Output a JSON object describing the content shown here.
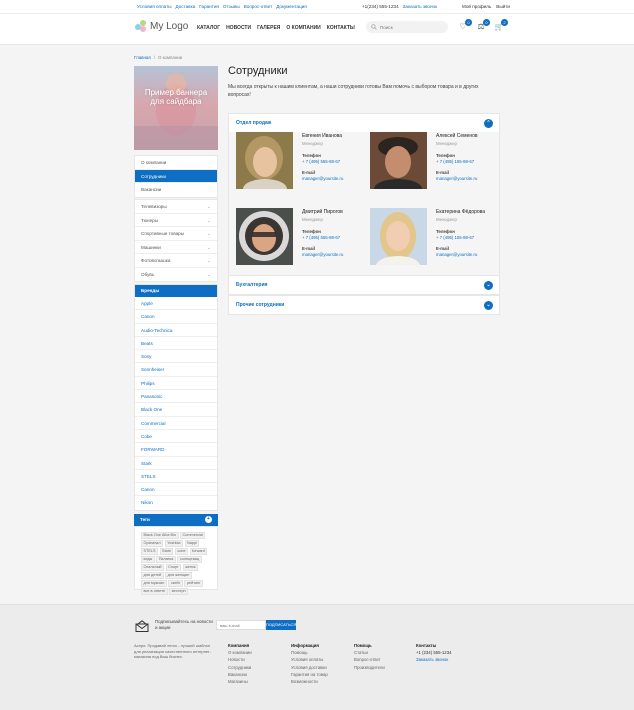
{
  "topbar": {
    "links": [
      "Условия оплаты",
      "Доставка",
      "Гарантия",
      "Отзывы",
      "Вопрос-ответ",
      "Документация"
    ],
    "phone": "+1(234) 555-1234",
    "callback": "Заказать звонок",
    "profile": "Мой профиль",
    "logout": "Выйти"
  },
  "header": {
    "logo": "My Logo",
    "nav": [
      "КАТАЛОГ",
      "НОВОСТИ",
      "ГАЛЕРЕЯ",
      "О КОМПАНИИ",
      "КОНТАКТЫ"
    ],
    "search_placeholder": "Поиск",
    "icons": [
      {
        "name": "favorites-icon",
        "glyph": "♡",
        "count": "0"
      },
      {
        "name": "compare-icon",
        "glyph": "⚖",
        "count": "0"
      },
      {
        "name": "cart-icon",
        "glyph": "🛒",
        "count": "2"
      }
    ]
  },
  "breadcrumb": {
    "home": "Главная",
    "sep": "/",
    "current": "О компании"
  },
  "banner": {
    "text": "Пример баннера для сайдбара"
  },
  "about_menu": [
    {
      "label": "О компании",
      "active": false
    },
    {
      "label": "Сотрудники",
      "active": true
    },
    {
      "label": "Вакансии",
      "active": false
    }
  ],
  "catalog_menu": [
    "Телевизоры",
    "Тюнеры",
    "Спортивные товары",
    "Машинки",
    "Фотовспышка",
    "Обувь"
  ],
  "brands": {
    "title": "Бренды",
    "items": [
      "Apple",
      "Canon",
      "Audio-Technica",
      "Beats",
      "Sony",
      "Sennheiser",
      "Philips",
      "Panasonic",
      "Black One",
      "Commercial",
      "Cobe",
      "FORWARD",
      "Stark",
      "STELS",
      "Canon",
      "Nikon"
    ]
  },
  "tags": {
    "title": "Теги",
    "plus": "+",
    "items": [
      "Black One Alba Bio",
      "Commercial",
      "Оригинал",
      "Yoshida",
      "Nappi",
      "STELS",
      "Stark",
      "cube",
      "forward",
      "кеды",
      "Палатка",
      "солнцезащ",
      "Спальный",
      "Спорт",
      "женск",
      "для детей",
      "для женщин",
      "для мужчин",
      "скейт",
      "рейтинг",
      "все в ответе",
      "вестерн"
    ]
  },
  "content": {
    "title": "Сотрудники",
    "intro": "Мы всегда открыты к нашим клиентам, а наши сотрудники готовы Вам помочь с выбором товара и в других вопросах!",
    "sections": [
      {
        "title": "Отдел продаж",
        "expanded": true,
        "toggle": "⌃"
      },
      {
        "title": "Бухгалтерия",
        "expanded": false,
        "toggle": "⌄"
      },
      {
        "title": "Прочие сотрудники",
        "expanded": false,
        "toggle": "⌄"
      }
    ],
    "employees": [
      {
        "name": "Евгения Иванова",
        "position": "Менеджер",
        "phone_label": "Телефон",
        "phone": "+ 7 (495) 555-88-67",
        "email_label": "E-mail",
        "email": "manager@yoursite.ru"
      },
      {
        "name": "Алексей Семенов",
        "position": "Менеджер",
        "phone_label": "Телефон",
        "phone": "+ 7 (495) 155-88-67",
        "email_label": "E-mail",
        "email": "manager@yoursite.ru"
      },
      {
        "name": "Дмитрий Пирогов",
        "position": "Менеджер",
        "phone_label": "Телефон",
        "phone": "+ 7 (495) 555-88-67",
        "email_label": "E-mail",
        "email": "manager@yoursite.ru"
      },
      {
        "name": "Екатерина Фёдорова",
        "position": "Менеджер",
        "phone_label": "Телефон",
        "phone": "+ 7 (495) 155-88-67",
        "email_label": "E-mail",
        "email": "manager@yoursite.ru"
      }
    ]
  },
  "footer": {
    "subscribe_text": "Подписывайтесь на новости и акции",
    "subscribe_placeholder": "ваш e-mail",
    "subscribe_button": "ПОДПИСАТЬСЯ",
    "about": "Аспро: Продавай легко - лучший шаблон для реализации качественного интернет-магазина под Ваш бизнес.",
    "columns": [
      {
        "title": "Компания",
        "items": [
          "О компании",
          "Новости",
          "Сотрудники",
          "Вакансии",
          "Магазины"
        ]
      },
      {
        "title": "Информация",
        "items": [
          "Помощь",
          "Условия оплаты",
          "Условия доставки",
          "Гарантия на товар",
          "Возможности"
        ]
      },
      {
        "title": "Помощь",
        "items": [
          "Статьи",
          "Вопрос-ответ",
          "Производители"
        ]
      },
      {
        "title": "Контакты",
        "items": [
          "+1 (234) 555-1234",
          "Заказать звонок"
        ]
      }
    ]
  }
}
